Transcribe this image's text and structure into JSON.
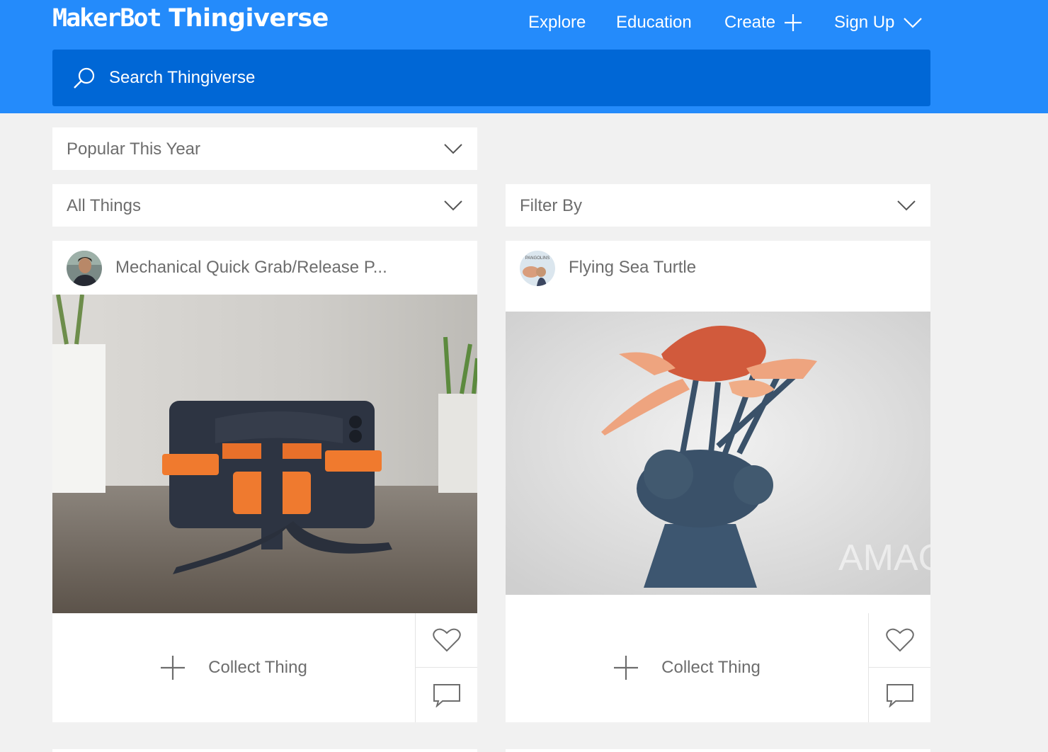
{
  "header": {
    "logo_part1": "MakerBot",
    "logo_part2": "Thingiverse",
    "nav": {
      "explore": "Explore",
      "education": "Education",
      "create": "Create",
      "signup": "Sign Up"
    },
    "search_placeholder": "Search Thingiverse"
  },
  "filters": {
    "sort": "Popular This Year",
    "type": "All Things",
    "filter_by": "Filter By"
  },
  "cards": [
    {
      "title": "Mechanical Quick Grab/Release P...",
      "collect_label": "Collect Thing"
    },
    {
      "title": "Flying Sea Turtle",
      "collect_label": "Collect Thing",
      "watermark": "AMAO",
      "avatar_text": "PANGOLINS"
    }
  ],
  "colors": {
    "header": "#248bfb",
    "search": "#0067d6",
    "background": "#f1f1f1",
    "card": "#ffffff",
    "text_muted": "#6d6d6d"
  },
  "icons": [
    "search-icon",
    "plus-icon",
    "chevron-down-icon",
    "heart-icon",
    "comment-icon"
  ]
}
